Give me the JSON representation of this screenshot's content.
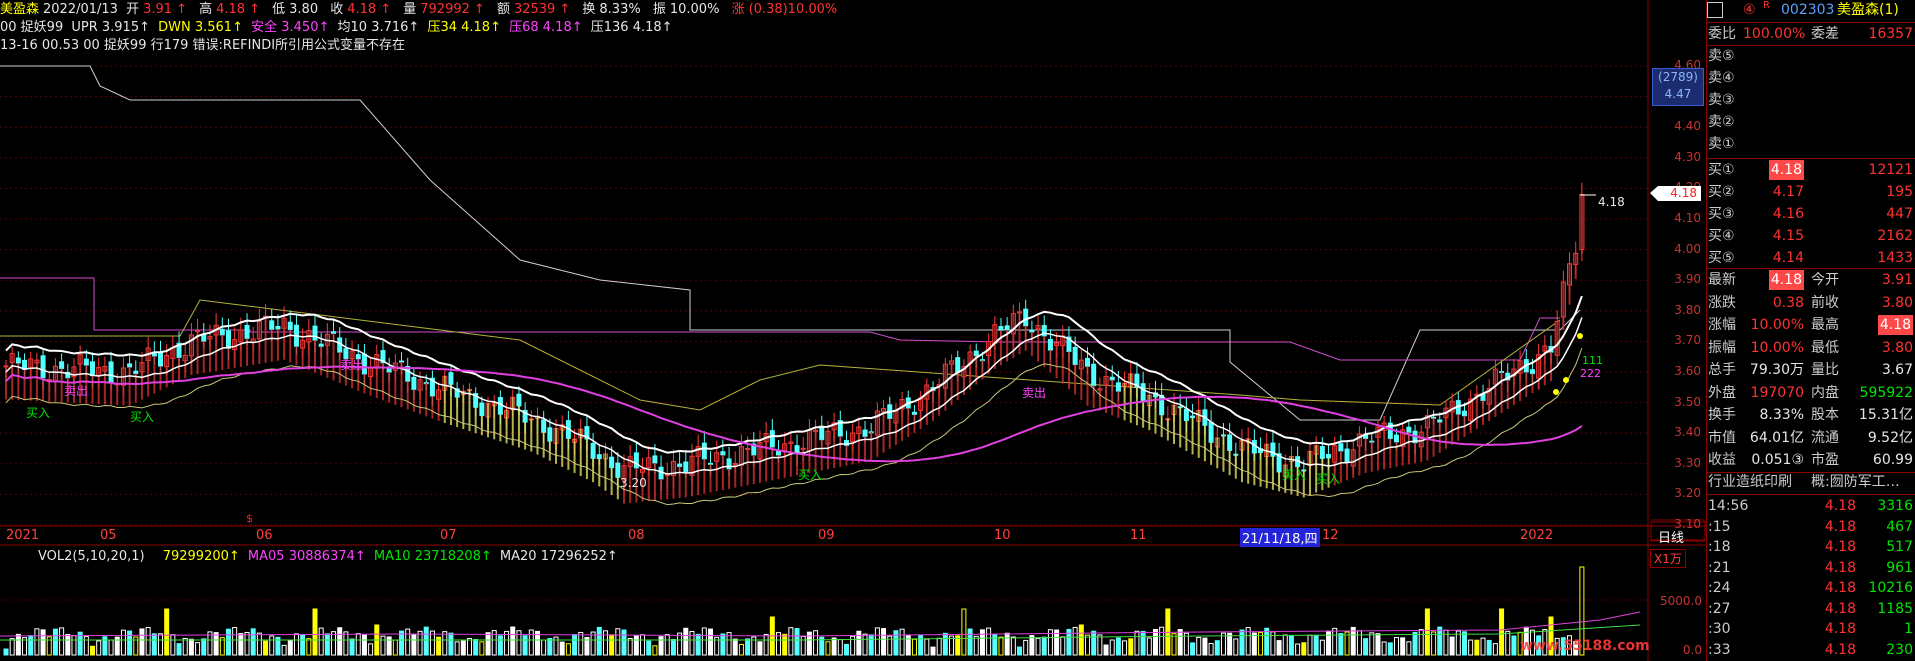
{
  "header": {
    "name": "美盈森",
    "date": "2022/01/13",
    "open_label": "开",
    "open": "3.91",
    "high_label": "高",
    "high": "4.18",
    "low_label": "低",
    "low": "3.80",
    "close_label": "收",
    "close": "4.18",
    "vol_label": "量",
    "vol": "792992",
    "amt_label": "额",
    "amt": "32539",
    "turnover_label": "换",
    "turnover": "8.33%",
    "amp_label": "振",
    "amp": "10.00%",
    "chg_label": "涨",
    "chg": "(0.38)10.00%",
    "line2": "00 捉妖99  UPR 3.915↑  DWN 3.561↑  安全 3.450↑ 均10 3.716↑ 压34 4.18↑  压68 4.18↑  压136 4.18↑",
    "line2_parts": {
      "p1": "00 捉妖99",
      "upr": "UPR 3.915↑",
      "dwn": "DWN 3.561↑",
      "safe": "安全 3.450↑",
      "avg10": "均10 3.716↑",
      "p34": "压34 4.18↑",
      "p68": "压68 4.18↑",
      "p136": "压136 4.18↑"
    },
    "line3": "13-16 00.53 00 捉妖99 行179 错误:REFINDI所引用公式变量不存在"
  },
  "price_axis": [
    "4.60",
    "4.50",
    "4.40",
    "4.30",
    "4.20",
    "4.10",
    "4.00",
    "3.90",
    "3.80",
    "3.70",
    "3.60",
    "3.50",
    "3.40",
    "3.30",
    "3.20",
    "3.10"
  ],
  "price_axis_box": {
    "top": "(2789)",
    "bottom": "4.47"
  },
  "current_price_tag": "4.18",
  "last_price_label": "4.18",
  "low_marker": "3.20",
  "signals": {
    "buy": "买入",
    "sell": "卖出"
  },
  "signal_counts": {
    "a": "111",
    "b": "222"
  },
  "date_axis": [
    "2021",
    "05",
    "06",
    "07",
    "08",
    "09",
    "10",
    "11",
    "21/11/18,四",
    "12",
    "2022"
  ],
  "period": "日线",
  "volume": {
    "header": "VOL2(5,10,20,1)",
    "vol": "79299200↑",
    "ma05_label": "MA05",
    "ma05": "30886374↑",
    "ma10_label": "MA10",
    "ma10": "23718208↑",
    "ma20_label": "MA20",
    "ma20": "17296252↑",
    "unit": "X1万",
    "axis": [
      "5000.0",
      "0.0"
    ]
  },
  "watermark": "www.55188.com",
  "panel": {
    "flag": "④",
    "flag2": "R",
    "code": "002303",
    "name": "美盈森(1)",
    "webi_label": "委比",
    "webi": "100.00%",
    "wecha_label": "委差",
    "wecha": "16357",
    "sells": [
      {
        "label": "卖⑤",
        "price": "",
        "vol": ""
      },
      {
        "label": "卖④",
        "price": "",
        "vol": ""
      },
      {
        "label": "卖③",
        "price": "",
        "vol": ""
      },
      {
        "label": "卖②",
        "price": "",
        "vol": ""
      },
      {
        "label": "卖①",
        "price": "",
        "vol": ""
      }
    ],
    "buys": [
      {
        "label": "买①",
        "price": "4.18",
        "vol": "12121"
      },
      {
        "label": "买②",
        "price": "4.17",
        "vol": "195"
      },
      {
        "label": "买③",
        "price": "4.16",
        "vol": "447"
      },
      {
        "label": "买④",
        "price": "4.15",
        "vol": "2162"
      },
      {
        "label": "买⑤",
        "price": "4.14",
        "vol": "1433"
      }
    ],
    "stats": [
      {
        "l1": "最新",
        "v1": "4.18",
        "l2": "今开",
        "v2": "3.91"
      },
      {
        "l1": "涨跌",
        "v1": "0.38",
        "l2": "前收",
        "v2": "3.80"
      },
      {
        "l1": "涨幅",
        "v1": "10.00%",
        "l2": "最高",
        "v2": "4.18"
      },
      {
        "l1": "振幅",
        "v1": "10.00%",
        "l2": "最低",
        "v2": "3.80"
      },
      {
        "l1": "总手",
        "v1": "79.30万",
        "l2": "量比",
        "v2": "3.67"
      },
      {
        "l1": "外盘",
        "v1": "197070",
        "l2": "内盘",
        "v2": "595922"
      },
      {
        "l1": "换手",
        "v1": "8.33%",
        "l2": "股本",
        "v2": "15.31亿"
      },
      {
        "l1": "市值",
        "v1": "64.01亿",
        "l2": "流通",
        "v2": "9.52亿"
      },
      {
        "l1": "收益",
        "v1": "0.051③",
        "l2": "市盈",
        "v2": "60.99"
      }
    ],
    "industry": "行业造纸印刷",
    "concept": "概:囫防军工…",
    "ticks": [
      {
        "t": "14:56",
        "p": "4.18",
        "v": "3316"
      },
      {
        "t": ":15",
        "p": "4.18",
        "v": "467"
      },
      {
        "t": ":18",
        "p": "4.18",
        "v": "517"
      },
      {
        "t": ":21",
        "p": "4.18",
        "v": "961"
      },
      {
        "t": ":24",
        "p": "4.18",
        "v": "10216"
      },
      {
        "t": ":27",
        "p": "4.18",
        "v": "1185"
      },
      {
        "t": ":30",
        "p": "4.18",
        "v": "1"
      },
      {
        "t": ":33",
        "p": "4.18",
        "v": "230"
      }
    ]
  }
}
